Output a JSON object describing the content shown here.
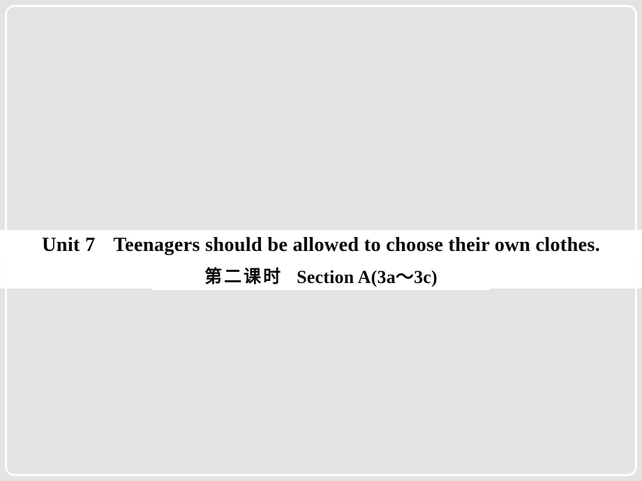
{
  "slide": {
    "background_color": "#ffffff",
    "panel_color": "#e2e3e3",
    "frame_color": "#fdfdfd",
    "text_color": "#0a0a0a",
    "title": {
      "unit_label": "Unit 7",
      "unit_heading": "Teenagers should be allowed to choose their own clothes.",
      "lesson_cn": "第二课时",
      "section_label": "Section A(3a～3c)"
    }
  }
}
